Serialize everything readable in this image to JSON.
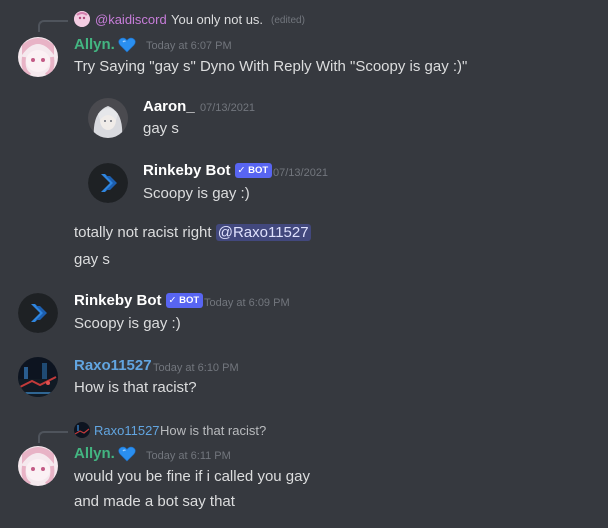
{
  "colors": {
    "background": "#36393f",
    "allyn_name": "#43b581",
    "raxo_name": "#62a5e0",
    "kaidiscord_name": "#c77dd9",
    "white_name": "#ffffff",
    "bot_badge": "#5865f2",
    "timestamp": "#72767d"
  },
  "reply1": {
    "mention": "@kaidiscord",
    "text": "You only not us.",
    "edited": "(edited)",
    "avatar_icon": "anime-avatar-icon"
  },
  "msg1": {
    "author": "Allyn.",
    "badge_icon": "blue-heart-icon",
    "timestamp": "Today at 6:07 PM",
    "lines": [
      "Try Saying \"gay s\" Dyno With Reply With \"Scoopy is gay :)\""
    ]
  },
  "embed1": {
    "author": "Aaron_",
    "timestamp": "07/13/2021",
    "text": "gay s"
  },
  "embed2": {
    "author": "Rinkeby Bot",
    "bot_label": "✓ BOT",
    "timestamp": "07/13/2021",
    "text": "Scoopy is gay :)"
  },
  "msg1_followups": {
    "line1_prefix": "totally not racist right",
    "line1_mention": "@Raxo11527",
    "line2": "gay s"
  },
  "msg2": {
    "author": "Rinkeby Bot",
    "bot_label": "✓ BOT",
    "timestamp": "Today at 6:09 PM",
    "text": "Scoopy is gay :)"
  },
  "msg3": {
    "author": "Raxo11527",
    "timestamp": "Today at 6:10 PM",
    "text": "How is that racist?"
  },
  "reply2": {
    "author": "Raxo11527",
    "text": "How is that racist?"
  },
  "msg4": {
    "author": "Allyn.",
    "badge_icon": "blue-heart-icon",
    "timestamp": "Today at 6:11 PM",
    "lines": [
      "would you be fine if i called you gay",
      "and made a bot say that"
    ]
  }
}
